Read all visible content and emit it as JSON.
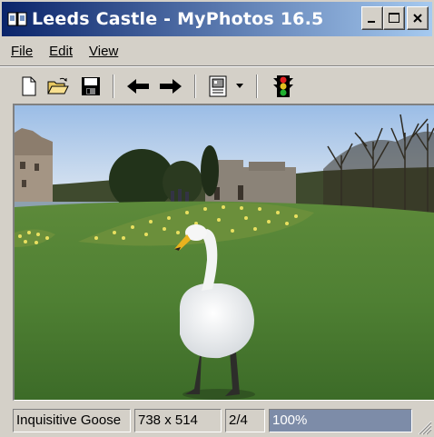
{
  "window": {
    "title": "Leeds Castle - MyPhotos 16.5",
    "app_icon": "photo-book-icon",
    "controls": [
      "minimize-icon",
      "maximize-icon",
      "close-icon"
    ]
  },
  "menu": {
    "file": "File",
    "edit": "Edit",
    "view": "View"
  },
  "toolbar": {
    "buttons": [
      "new-document-icon",
      "open-folder-icon",
      "save-disk-icon",
      "back-arrow-icon",
      "forward-arrow-icon",
      "slideshow-icon",
      "dropdown-arrow-icon",
      "traffic-light-icon"
    ]
  },
  "photo": {
    "subject": "swan-on-lawn-photo"
  },
  "status": {
    "caption": "Inquisitive Goose",
    "dimensions": "738 x 514",
    "position": "2/4",
    "zoom": "100%"
  },
  "colors": {
    "title_start": "#0a246a",
    "title_end": "#a6caf0",
    "chrome": "#d4d0c8",
    "zoom_pane": "#7d8ca8"
  }
}
